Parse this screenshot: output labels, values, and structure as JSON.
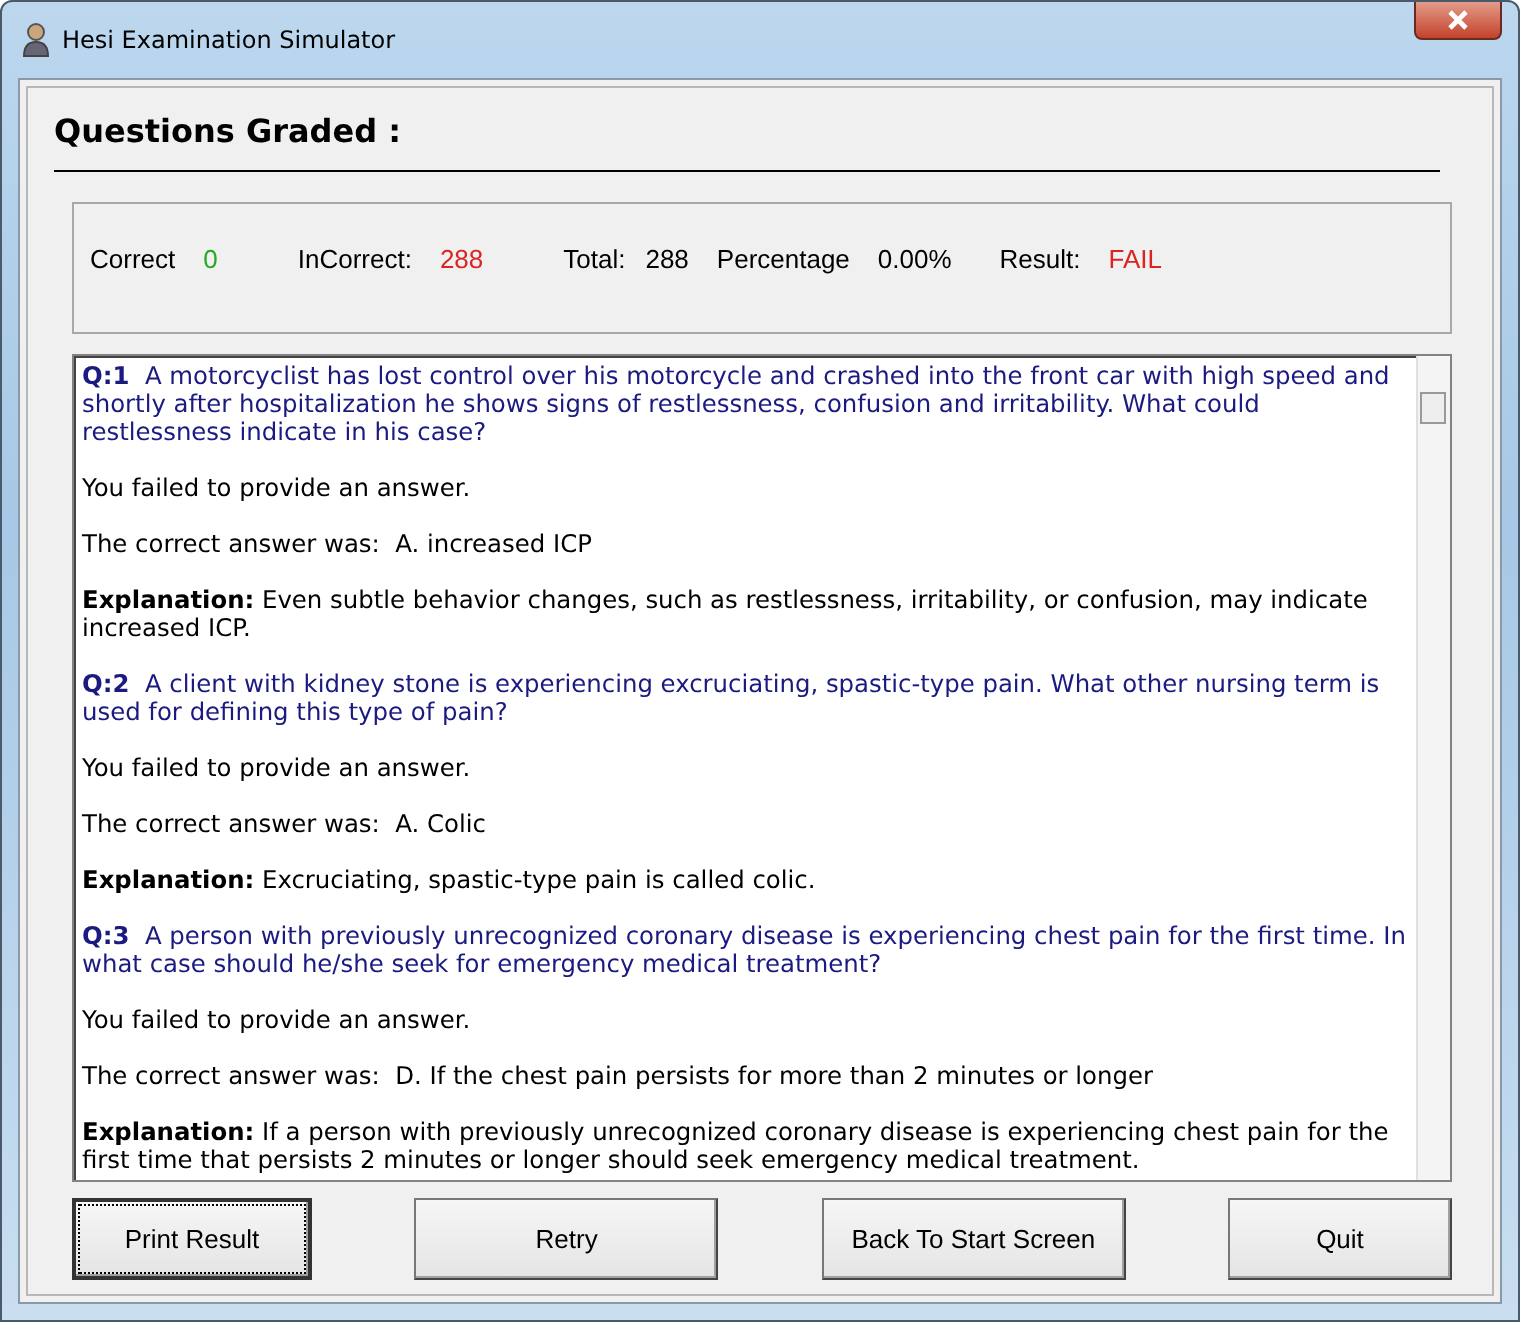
{
  "window": {
    "title": "Hesi Examination Simulator"
  },
  "heading": "Questions Graded :",
  "stats": [
    {
      "label": "Correct",
      "value": "0",
      "color": "#22aa22"
    },
    {
      "label": "InCorrect:",
      "value": "288",
      "color": "#dd2222"
    },
    {
      "label": "Total:",
      "value": "288",
      "color": "#000000"
    },
    {
      "label": "Percentage",
      "value": "0.00%",
      "color": "#000000"
    },
    {
      "label": "Result:",
      "value": "FAIL",
      "color": "#dd2222"
    }
  ],
  "results": [
    {
      "question": "**Q:1**  A motorcyclist has lost control over his motorcycle and crashed into the front car with high speed and shortly after hospitalization he shows signs of restlessness, confusion and irritability. What could restlessness indicate in his case?",
      "status": "You failed to provide an answer.",
      "correct_answer": "The correct answer was:  A. increased ICP",
      "explanation": "**Explanation:** Even subtle behavior changes, such as restlessness, irritability, or confusion, may indicate increased ICP."
    },
    {
      "question": "**Q:2**  A client with kidney stone is experiencing excruciating, spastic-type pain. What other nursing term is used for defining this type of pain?",
      "status": "You failed to provide an answer.",
      "correct_answer": "The correct answer was:  A. Colic",
      "explanation": "**Explanation:** Excruciating, spastic-type pain is called colic."
    },
    {
      "question": "**Q:3**  A person with previously unrecognized coronary disease is experiencing chest pain for the first time. In what case should he/she seek for emergency medical treatment?",
      "status": "You failed to provide an answer.",
      "correct_answer": "The correct answer was:  D. If the chest pain persists for more than 2 minutes or longer",
      "explanation": "**Explanation:** If a person with previously unrecognized coronary disease is experiencing chest pain for the first time that persists 2 minutes or longer should seek emergency medical treatment."
    }
  ],
  "buttons": [
    {
      "label": "Print Result",
      "focused": true
    },
    {
      "label": "Retry",
      "focused": false
    },
    {
      "label": "Back To Start Screen",
      "focused": false
    },
    {
      "label": "Quit",
      "focused": false
    }
  ]
}
